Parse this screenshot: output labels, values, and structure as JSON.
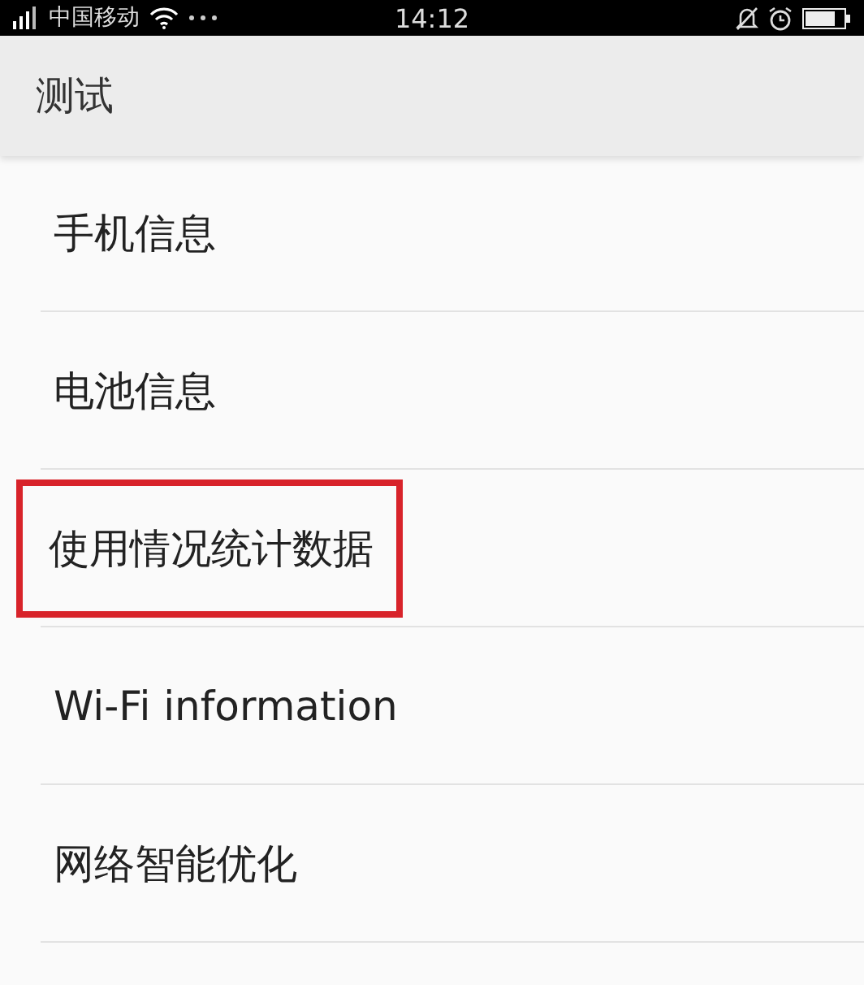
{
  "status_bar": {
    "carrier": "中国移动",
    "time": "14:12"
  },
  "title": "测试",
  "items": [
    {
      "label": "手机信息",
      "highlighted": false
    },
    {
      "label": "电池信息",
      "highlighted": false
    },
    {
      "label": "使用情况统计数据",
      "highlighted": true
    },
    {
      "label": "Wi-Fi information",
      "highlighted": false
    },
    {
      "label": "网络智能优化",
      "highlighted": false
    }
  ]
}
